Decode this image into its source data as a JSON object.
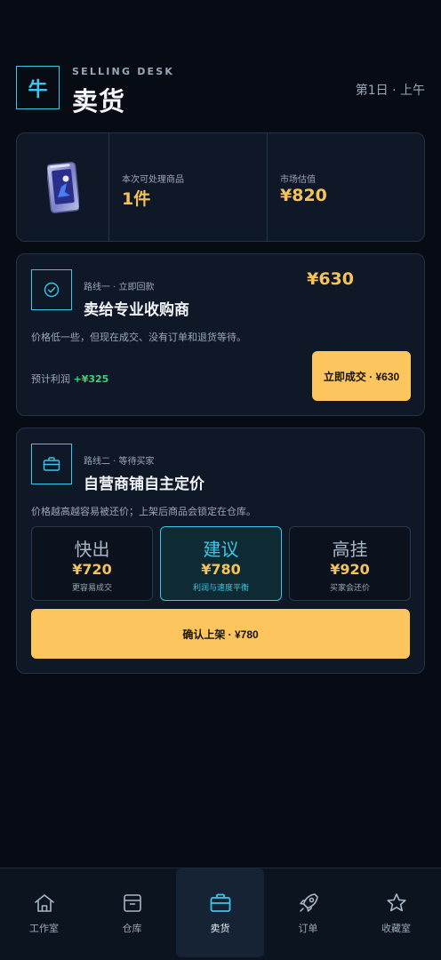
{
  "header": {
    "logo_char": "牛",
    "eyebrow": "SELLING DESK",
    "title": "卖货",
    "time": "第1日 · 上午"
  },
  "summary": {
    "item_icon": "trading-card-icon",
    "count_label": "本次可处理商品",
    "count_value": "1件",
    "estimate_label": "市场估值",
    "estimate_value": "¥820"
  },
  "route1": {
    "icon": "check-circle-icon",
    "tag": "路线一 · 立即回款",
    "title": "卖给专业收购商",
    "price": "¥630",
    "desc": "价格低一些，但现在成交、没有订单和退货等待。",
    "profit_label": "预计利润",
    "profit_value": "+¥325",
    "button": "立即成交 · ¥630"
  },
  "route2": {
    "icon": "briefcase-icon",
    "tag": "路线二 · 等待买家",
    "title": "自营商铺自主定价",
    "desc": "价格越高越容易被还价；上架后商品会锁定在仓库。",
    "options": [
      {
        "name": "快出",
        "price": "¥720",
        "note": "更容易成交",
        "selected": false
      },
      {
        "name": "建议",
        "price": "¥780",
        "note": "利润与速度平衡",
        "selected": true
      },
      {
        "name": "高挂",
        "price": "¥920",
        "note": "买家会还价",
        "selected": false
      }
    ],
    "button": "确认上架 · ¥780"
  },
  "tabs": [
    {
      "label": "工作室",
      "icon": "home-icon",
      "active": false
    },
    {
      "label": "仓库",
      "icon": "box-icon",
      "active": false
    },
    {
      "label": "卖货",
      "icon": "briefcase-icon",
      "active": true
    },
    {
      "label": "订单",
      "icon": "rocket-icon",
      "active": false
    },
    {
      "label": "收藏室",
      "icon": "star-icon",
      "active": false
    }
  ],
  "colors": {
    "accent": "#3ec6ea",
    "price": "#f6c35a",
    "button": "#fcc55d",
    "profit": "#3fd27a",
    "background": "#070c14"
  }
}
